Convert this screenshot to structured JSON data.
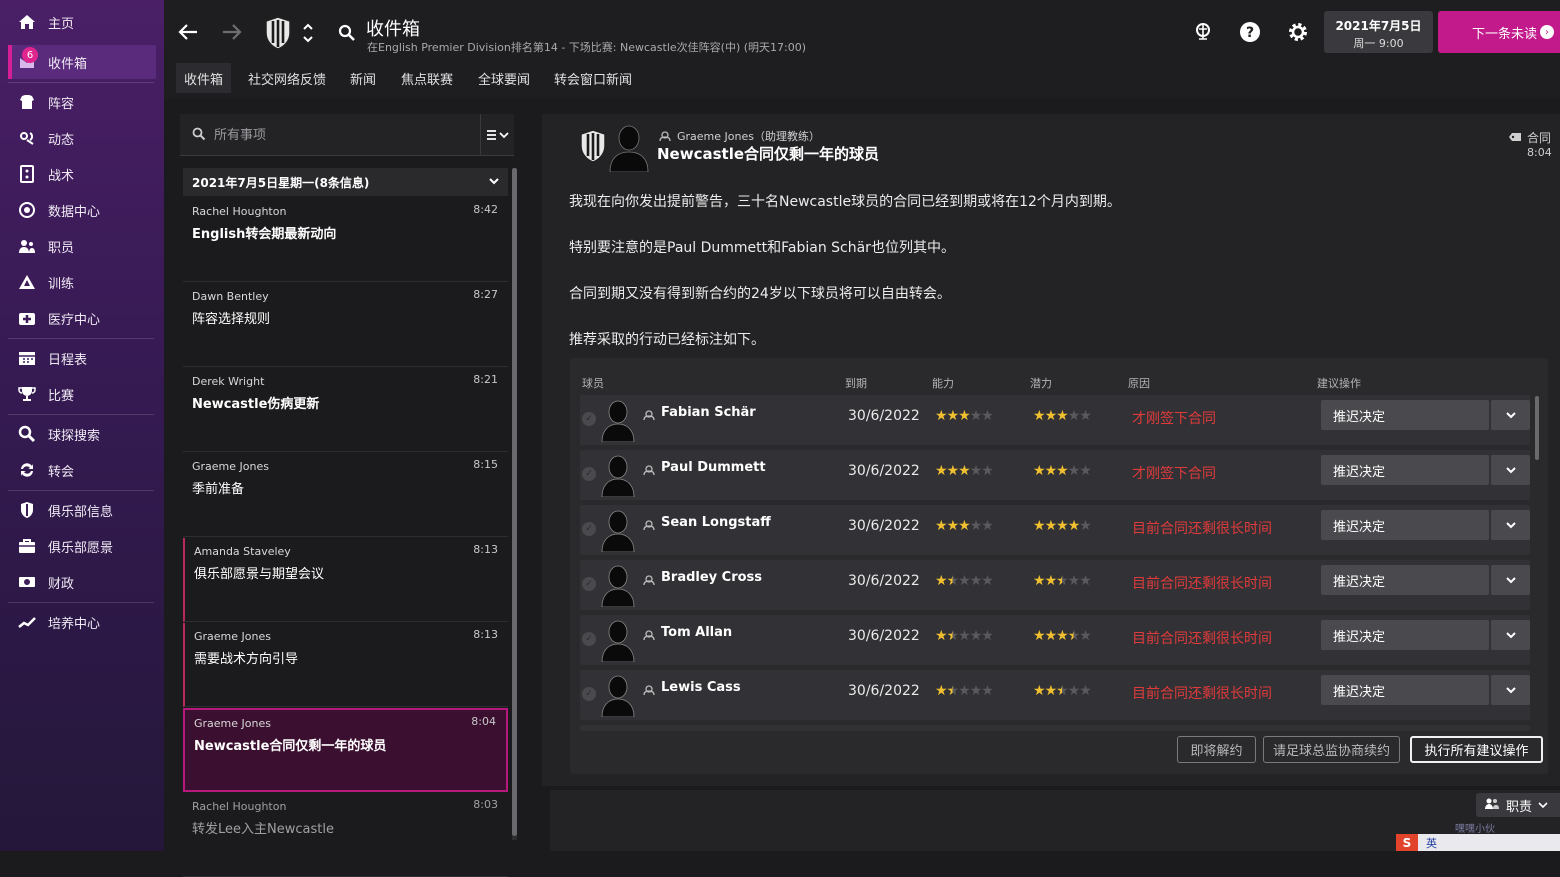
{
  "sidebar": {
    "items": [
      {
        "label": "主页",
        "icon": "home-icon"
      },
      {
        "label": "收件箱",
        "icon": "inbox-icon",
        "badge": "6",
        "active": true
      },
      {
        "label": "阵容",
        "icon": "squad-icon"
      },
      {
        "label": "动态",
        "icon": "dynamics-icon"
      },
      {
        "label": "战术",
        "icon": "tactics-icon"
      },
      {
        "label": "数据中心",
        "icon": "data-hub-icon"
      },
      {
        "label": "职员",
        "icon": "staff-icon"
      },
      {
        "label": "训练",
        "icon": "training-icon"
      },
      {
        "label": "医疗中心",
        "icon": "medical-icon"
      },
      {
        "label": "日程表",
        "icon": "schedule-icon"
      },
      {
        "label": "比赛",
        "icon": "trophy-icon"
      },
      {
        "label": "球探搜索",
        "icon": "scouting-icon"
      },
      {
        "label": "转会",
        "icon": "transfer-icon"
      },
      {
        "label": "俱乐部信息",
        "icon": "club-info-icon"
      },
      {
        "label": "俱乐部愿景",
        "icon": "club-vision-icon"
      },
      {
        "label": "财政",
        "icon": "finances-icon"
      },
      {
        "label": "培养中心",
        "icon": "development-icon"
      }
    ]
  },
  "header": {
    "title": "收件箱",
    "subtitle": "在English Premier Division排名第14 - 下场比赛: Newcastle次佳阵容(中) (明天17:00)",
    "date_line1": "2021年7月5日",
    "date_line2": "周一 9:00",
    "next_button": "下一条未读",
    "tabs": [
      "收件箱",
      "社交网络反馈",
      "新闻",
      "焦点联赛",
      "全球要闻",
      "转会窗口新闻"
    ]
  },
  "inbox": {
    "search_placeholder": "所有事项",
    "group_header": "2021年7月5日星期一(8条信息)",
    "messages": [
      {
        "sender": "Rachel Houghton",
        "time": "8:42",
        "subject": "English转会期最新动向"
      },
      {
        "sender": "Dawn Bentley",
        "time": "8:27",
        "subject": "阵容选择规则"
      },
      {
        "sender": "Derek Wright",
        "time": "8:21",
        "subject": "Newcastle伤病更新"
      },
      {
        "sender": "Graeme Jones",
        "time": "8:15",
        "subject": "季前准备"
      },
      {
        "sender": "Amanda Staveley",
        "time": "8:13",
        "subject": "俱乐部愿景与期望会议"
      },
      {
        "sender": "Graeme Jones",
        "time": "8:13",
        "subject": "需要战术方向引导"
      },
      {
        "sender": "Graeme Jones",
        "time": "8:04",
        "subject": "Newcastle合同仅剩一年的球员"
      },
      {
        "sender": "Rachel Houghton",
        "time": "8:03",
        "subject": "转发Lee入主Newcastle"
      }
    ]
  },
  "message": {
    "sender": "Graeme Jones（助理教练）",
    "subject": "Newcastle合同仅剩一年的球员",
    "label": "合同",
    "time": "8:04",
    "body": [
      "我现在向你发出提前警告，三十名Newcastle球员的合同已经到期或将在12个月内到期。",
      "特别要注意的是Paul Dummett和Fabian Schär也位列其中。",
      "合同到期又没有得到新合约的24岁以下球员将可以自由转会。",
      "推荐采取的行动已经标注如下。"
    ],
    "table": {
      "headers": {
        "player": "球员",
        "expiry": "到期",
        "ability": "能力",
        "potential": "潜力",
        "reason": "原因",
        "action": "建议操作"
      },
      "rows": [
        {
          "name": "Fabian Schär",
          "expiry": "30/6/2022",
          "ability": 3,
          "potential": 3,
          "reason": "才刚签下合同",
          "action": "推迟决定"
        },
        {
          "name": "Paul Dummett",
          "expiry": "30/6/2022",
          "ability": 3,
          "potential": 3,
          "reason": "才刚签下合同",
          "action": "推迟决定"
        },
        {
          "name": "Sean Longstaff",
          "expiry": "30/6/2022",
          "ability": 3,
          "potential": 4,
          "reason": "目前合同还剩很长时间",
          "action": "推迟决定"
        },
        {
          "name": "Bradley Cross",
          "expiry": "30/6/2022",
          "ability": 1.5,
          "potential": 2.5,
          "reason": "目前合同还剩很长时间",
          "action": "推迟决定"
        },
        {
          "name": "Tom Allan",
          "expiry": "30/6/2022",
          "ability": 1.5,
          "potential": 3.5,
          "reason": "目前合同还剩很长时间",
          "action": "推迟决定"
        },
        {
          "name": "Lewis Cass",
          "expiry": "30/6/2022",
          "ability": 1.5,
          "potential": 2.5,
          "reason": "目前合同还剩很长时间",
          "action": "推迟决定"
        }
      ]
    },
    "buttons": {
      "release": "即将解约",
      "ask_director": "请足球总监协商续约",
      "execute_all": "执行所有建议操作"
    }
  },
  "bottom": {
    "role_button": "职责",
    "watermark": "嘿嘿小伙"
  },
  "ime": {
    "mode": "英"
  },
  "colors": {
    "accent": "#c2198b",
    "sidebar": "#4a1f66",
    "star": "#f0c030",
    "reason_red": "#e03a3a"
  }
}
